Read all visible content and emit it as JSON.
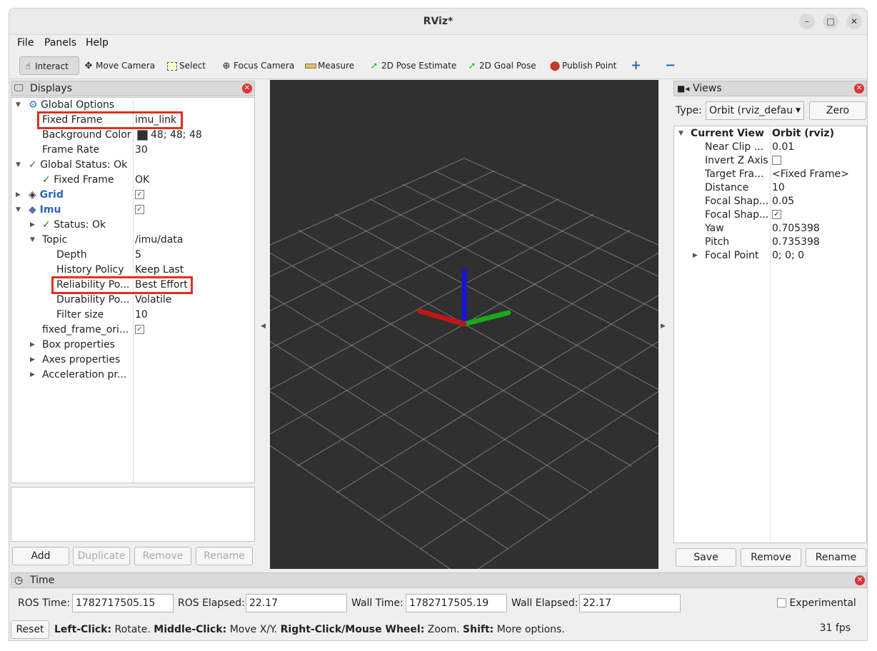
{
  "window": {
    "title": "RViz*"
  },
  "menu": [
    "File",
    "Panels",
    "Help"
  ],
  "toolbar": {
    "tools": [
      {
        "label": "Interact",
        "icon": "hand-pointer-icon"
      },
      {
        "label": "Move Camera",
        "icon": "move-camera-icon"
      },
      {
        "label": "Select",
        "icon": "select-rect-icon"
      },
      {
        "label": "Focus Camera",
        "icon": "focus-camera-icon"
      },
      {
        "label": "Measure",
        "icon": "ruler-icon"
      },
      {
        "label": "2D Pose Estimate",
        "icon": "green-arrow-icon"
      },
      {
        "label": "2D Goal Pose",
        "icon": "green-arrow-icon"
      },
      {
        "label": "Publish Point",
        "icon": "map-pin-icon"
      }
    ]
  },
  "displays": {
    "title": "Displays",
    "rows": [
      {
        "name": "Global Options",
        "value": ""
      },
      {
        "name": "Fixed Frame",
        "value": "imu_link"
      },
      {
        "name": "Background Color",
        "value": "48; 48; 48"
      },
      {
        "name": "Frame Rate",
        "value": "30"
      },
      {
        "name": "Global Status: Ok",
        "value": ""
      },
      {
        "name": "Fixed Frame",
        "value": "OK"
      },
      {
        "name": "Grid",
        "value": ""
      },
      {
        "name": "Imu",
        "value": ""
      },
      {
        "name": "Status: Ok",
        "value": ""
      },
      {
        "name": "Topic",
        "value": "/imu/data"
      },
      {
        "name": "Depth",
        "value": "5"
      },
      {
        "name": "History Policy",
        "value": "Keep Last"
      },
      {
        "name": "Reliability Po...",
        "value": "Best Effort"
      },
      {
        "name": "Durability Po...",
        "value": "Volatile"
      },
      {
        "name": "Filter size",
        "value": "10"
      },
      {
        "name": "fixed_frame_ori...",
        "value": ""
      },
      {
        "name": "Box properties",
        "value": ""
      },
      {
        "name": "Axes properties",
        "value": ""
      },
      {
        "name": "Acceleration pr...",
        "value": ""
      }
    ],
    "bg_swatch": "#303030",
    "buttons": {
      "add": "Add",
      "duplicate": "Duplicate",
      "remove": "Remove",
      "rename": "Rename"
    }
  },
  "views": {
    "title": "Views",
    "type_label": "Type:",
    "type_value": "Orbit (rviz_defau",
    "zero": "Zero",
    "rows": [
      {
        "name": "Current View",
        "value": "Orbit (rviz)"
      },
      {
        "name": "Near Clip ...",
        "value": "0.01"
      },
      {
        "name": "Invert Z Axis",
        "value": ""
      },
      {
        "name": "Target Fra...",
        "value": "<Fixed Frame>"
      },
      {
        "name": "Distance",
        "value": "10"
      },
      {
        "name": "Focal Shap...",
        "value": "0.05"
      },
      {
        "name": "Focal Shap...",
        "value": ""
      },
      {
        "name": "Yaw",
        "value": "0.705398"
      },
      {
        "name": "Pitch",
        "value": "0.735398"
      },
      {
        "name": "Focal Point",
        "value": "0; 0; 0"
      }
    ],
    "buttons": {
      "save": "Save",
      "remove": "Remove",
      "rename": "Rename"
    }
  },
  "time": {
    "title": "Time",
    "ros_time_label": "ROS Time:",
    "ros_time": "1782717505.15",
    "ros_elapsed_label": "ROS Elapsed:",
    "ros_elapsed": "22.17",
    "wall_time_label": "Wall Time:",
    "wall_time": "1782717505.19",
    "wall_elapsed_label": "Wall Elapsed:",
    "wall_elapsed": "22.17",
    "experimental": "Experimental"
  },
  "status": {
    "reset": "Reset",
    "help_parts": [
      {
        "b": "Left-Click:",
        "t": " Rotate. "
      },
      {
        "b": "Middle-Click:",
        "t": " Move X/Y. "
      },
      {
        "b": "Right-Click/Mouse Wheel:",
        "t": " Zoom. "
      },
      {
        "b": "Shift:",
        "t": " More options."
      }
    ],
    "fps": "31 fps"
  },
  "viewport": {
    "background": "#303030",
    "grid_color": "#a0a0a0"
  }
}
